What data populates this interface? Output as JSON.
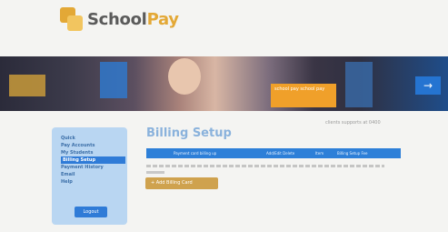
{
  "brand": {
    "name_prefix": "School",
    "name_suffix": "Pay"
  },
  "banner": {
    "promo_text": "school pay school pay",
    "arrow": "→"
  },
  "meta": {
    "text": "clients supports at 0400"
  },
  "page": {
    "title": "Billing Setup"
  },
  "sidebar": {
    "items": [
      {
        "label": "Quick"
      },
      {
        "label": "Pay Accounts"
      },
      {
        "label": "My Students"
      },
      {
        "label": "Billing Setup"
      },
      {
        "label": "Payment History"
      },
      {
        "label": "Email"
      },
      {
        "label": "Help"
      }
    ],
    "button_label": "Logout"
  },
  "tabbar": {
    "columns": [
      "Payment card billing up",
      "Add/Edit Delete",
      "Item",
      "Billing Setup Fee"
    ]
  },
  "actions": {
    "add_label": "+ Add Billing Card"
  },
  "colors": {
    "accent_blue": "#2d7fd8",
    "gold": "#cfa24e",
    "sidebar_bg": "#b9d6f2"
  }
}
